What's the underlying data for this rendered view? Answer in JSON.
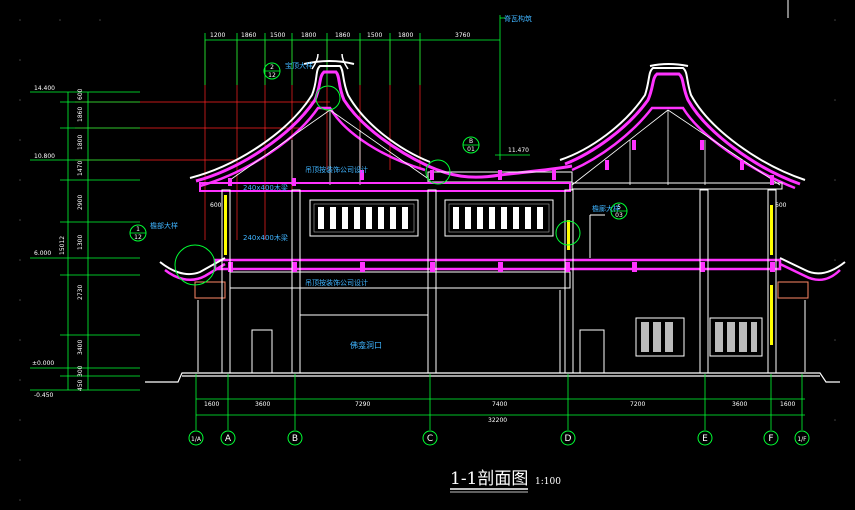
{
  "drawing": {
    "title": "1-1剖面图",
    "scale": "1:100"
  },
  "top_dims": [
    "1200",
    "1860",
    "1500",
    "1800",
    "1860",
    "1500",
    "1800",
    "3760"
  ],
  "top_note": "脊瓦构筑",
  "bottom_dims": [
    "1600",
    "3600",
    "7290",
    "7400",
    "7200",
    "3600",
    "1600"
  ],
  "bottom_total": "32200",
  "axes": [
    "1/A",
    "A",
    "B",
    "C",
    "D",
    "E",
    "F",
    "1/F"
  ],
  "left_elevations": [
    "14.400",
    "10.800",
    "6.000",
    "±0.000",
    "-0.450"
  ],
  "left_dims": [
    "600",
    "1860",
    "1800",
    "1470",
    "2900",
    "1300",
    "2730",
    "3400",
    "300",
    "450"
  ],
  "left_total": "15012",
  "right_elevation": "11.470",
  "callouts": [
    {
      "num": "2",
      "sheet": "12",
      "label": "宝顶大样"
    },
    {
      "num": "B",
      "sheet": "01",
      "label": ""
    },
    {
      "num": "1",
      "sheet": "12",
      "label": "檐部大样"
    },
    {
      "num": "5",
      "sheet": "03",
      "label": "檐廊大样"
    }
  ],
  "notes": {
    "ceiling_top": "吊顶按装饰公司设计",
    "ceiling_mid": "吊顶按装饰公司设计",
    "beam1": "240x400木梁",
    "beam2": "240x400木梁",
    "opening": "佛龛洞口",
    "dim_600": "600"
  },
  "colors": {
    "background": "#000000",
    "structure": "#ffffff",
    "roof": "#ff33ff",
    "dimension": "#00ff33",
    "grid": "#ff2222",
    "note": "#3fb4ff",
    "column": "#ffff00"
  }
}
